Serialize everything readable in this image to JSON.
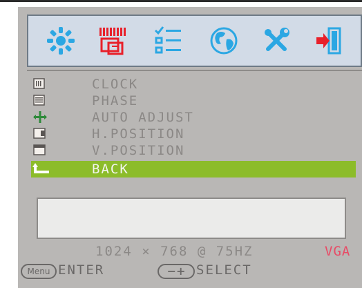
{
  "icons": {
    "tabs": [
      "brightness-icon",
      "image-setup-icon",
      "color-menu-icon",
      "osd-language-icon",
      "tools-icon",
      "exit-icon"
    ]
  },
  "menu": {
    "items": [
      {
        "label": "CLOCK",
        "icon": "clock-icon"
      },
      {
        "label": "PHASE",
        "icon": "phase-icon"
      },
      {
        "label": "AUTO ADJUST",
        "icon": "auto-adjust-icon"
      },
      {
        "label": "H.POSITION",
        "icon": "h-position-icon"
      },
      {
        "label": "V.POSITION",
        "icon": "v-position-icon"
      },
      {
        "label": "BACK",
        "icon": "back-icon",
        "selected": true
      }
    ]
  },
  "status": {
    "resolution": "1024 × 768 @ 75HZ",
    "source": "VGA"
  },
  "hints": {
    "menu_key": "Menu",
    "enter": "ENTER",
    "adjust_key": "−+",
    "select": "SELECT"
  },
  "colors": {
    "accent": "#8cbc2a",
    "source": "#e84b66",
    "panel": "#b9b7b5",
    "iconbar": "#d2dbe7"
  }
}
